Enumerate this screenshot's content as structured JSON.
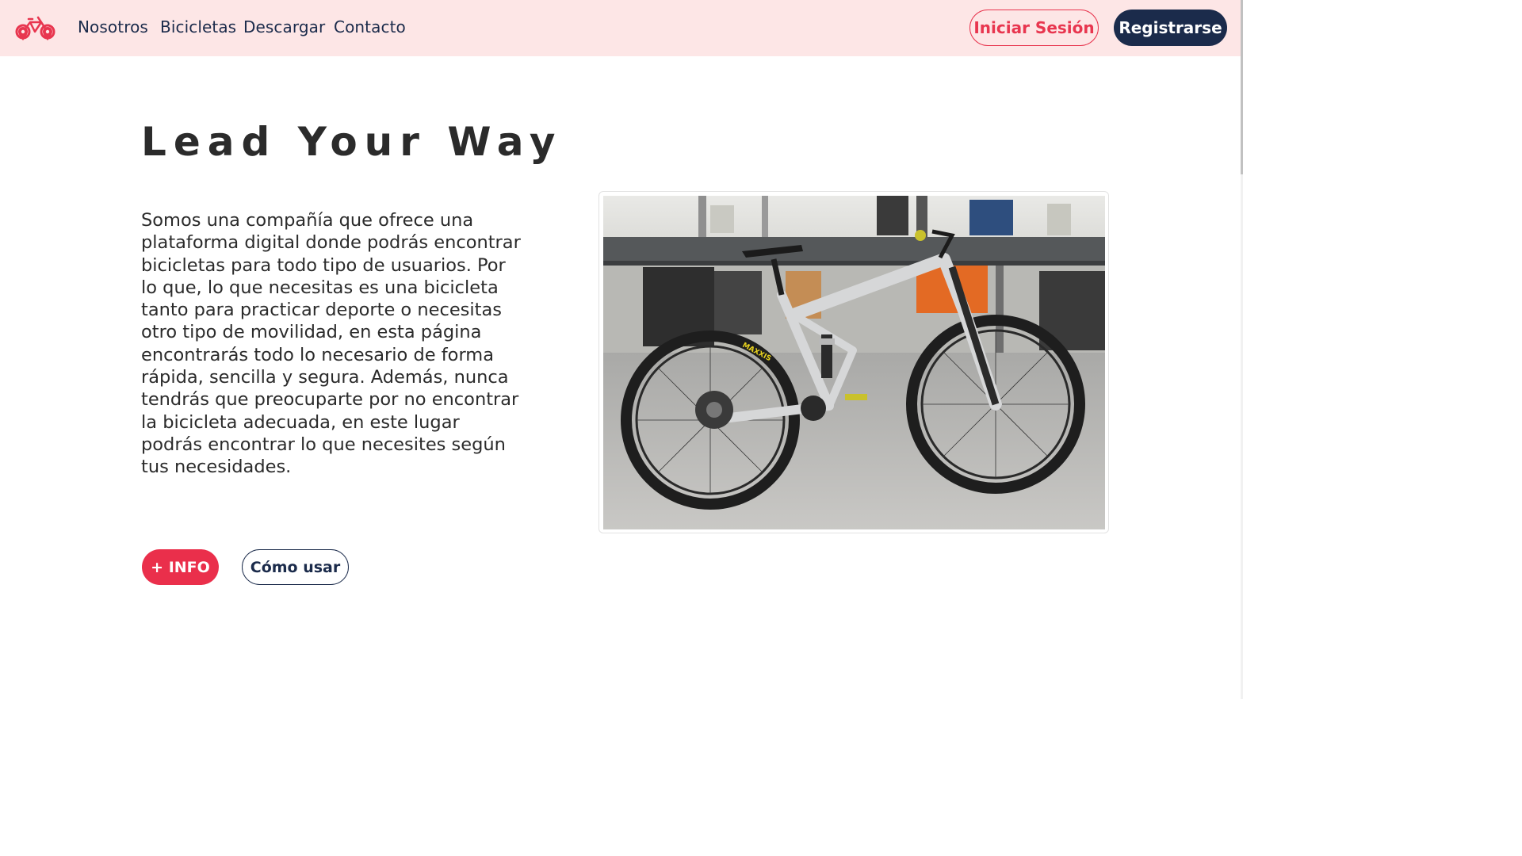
{
  "nav": {
    "logo_icon": "bike-location-icon",
    "links": [
      "Nosotros",
      "Bicicletas",
      "Descargar",
      "Contacto"
    ],
    "login_label": "Iniciar Sesión",
    "register_label": "Registrarse"
  },
  "hero": {
    "title": "Lead Your Way",
    "description": "Somos una compañía que ofrece una plataforma digital donde podrás encontrar bicicletas para todo tipo de usuarios. Por lo que, lo que necesitas es una bicicleta tanto para practicar deporte o necesitas otro tipo de movilidad, en esta página encontrarás todo lo necesario de forma rápida, sencilla y segura. Además, nunca tendrás que preocuparte por no encontrar la bicicleta adecuada, en este lugar podrás encontrar lo que necesites según tus necesidades.",
    "info_button": "+ INFO",
    "howto_button": "Cómo usar",
    "tire_brand": "MAXXIS"
  },
  "colors": {
    "navbar_bg": "#fde6e6",
    "accent": "#ea2f4b",
    "navy": "#1b2b4b"
  }
}
